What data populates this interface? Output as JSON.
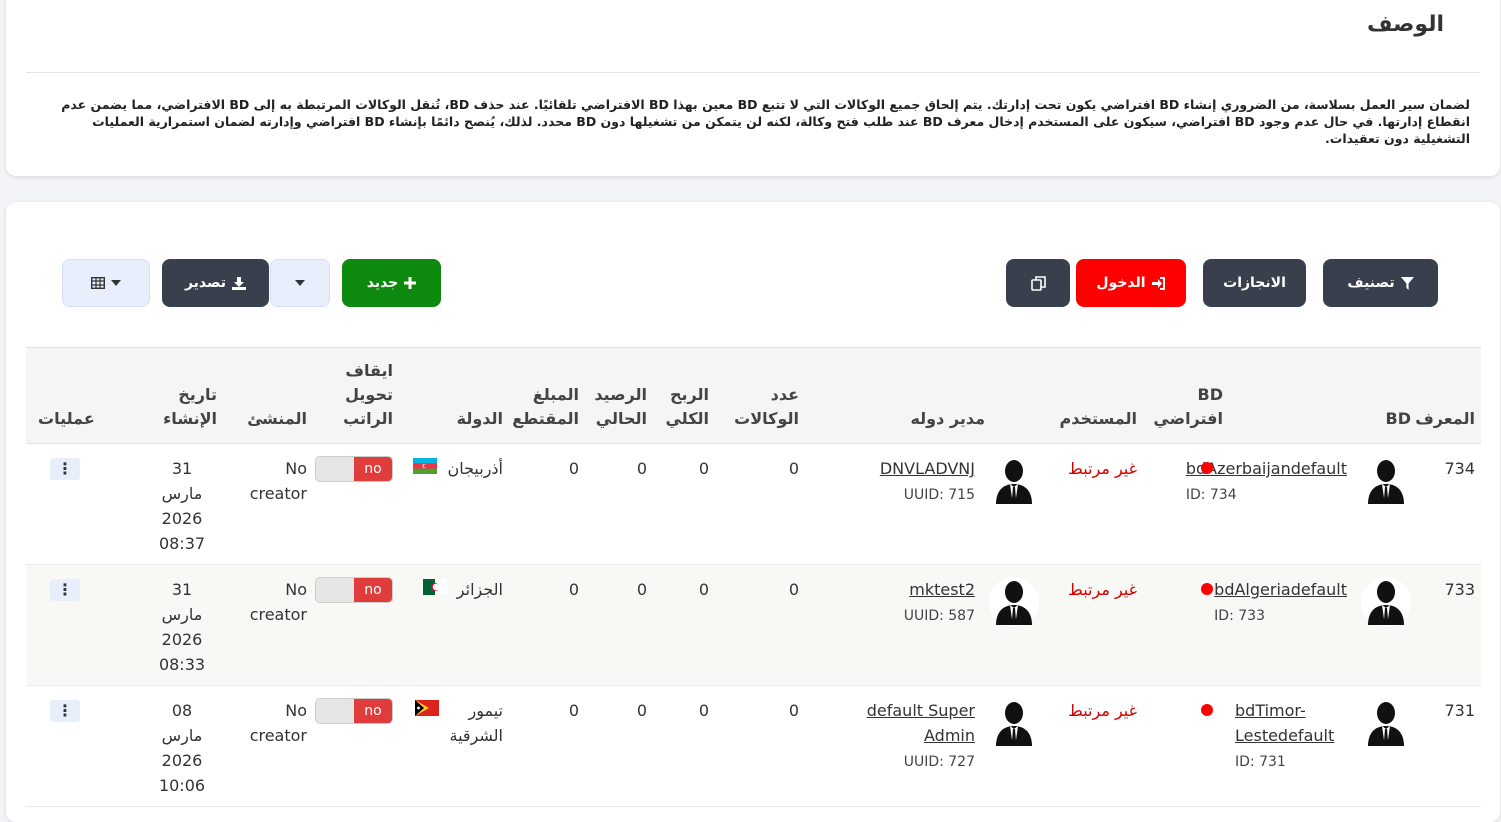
{
  "description": {
    "title": "الوصف",
    "text": "لضمان سير العمل بسلاسة، من الضروري إنشاء BD افتراضي يكون تحت إدارتك. يتم إلحاق جميع الوكالات التي لا تتبع BD معين بهذا BD الافتراضي تلقائيًا. عند حذف BD، تُنقل الوكالات المرتبطة به إلى BD الافتراضي، مما يضمن عدم انقطاع إدارتها. في حال عدم وجود BD افتراضي، سيكون على المستخدم إدخال معرف BD عند طلب فتح وكالة، لكنه لن يتمكن من تشغيلها دون BD محدد. لذلك، يُنصح دائمًا بإنشاء BD افتراضي وإدارته لضمان استمرارية العمليات التشغيلية دون تعقيدات."
  },
  "toolbar": {
    "filter_label": "تصنيف",
    "achievements_label": "الانجازات",
    "login_label": "الدخول",
    "new_label": "جديد",
    "export_label": "تصدير"
  },
  "colors": {
    "login": "#ff0000",
    "new": "#0d8a0d",
    "dark": "#3a3f4d",
    "status_red": "#d40000"
  },
  "table": {
    "headers": {
      "id": "المعرف",
      "bd": "BD",
      "default_bd": "BD افتراضي",
      "user": "المستخدم",
      "manager": "مدير دوله",
      "agency_count": "عدد الوكالات",
      "total_profit": "الربح الكلي",
      "balance": "الرصيد الحالي",
      "deducted": "المبلغ المقتطع",
      "country": "الدولة",
      "stop_salary": "ايقاف تحويل الراتب",
      "creator": "المنشئ",
      "created_at": "تاريخ الإنشاء",
      "actions": "عمليات"
    },
    "rows": [
      {
        "id": "734",
        "bd_name": "bdAzerbaijandefault",
        "bd_id": "ID: 734",
        "user_status": "غير مرتبط",
        "manager_name": "DNVLADVNJ",
        "manager_uuid": "UUID: 715",
        "agency_count": "0",
        "total_profit": "0",
        "balance": "0",
        "deducted": "0",
        "country": "أذربيجان",
        "flag": "azerbaijan-flag",
        "toggle": "no",
        "creator": "No creator",
        "date_day": "31",
        "date_month": "مارس",
        "date_year": "2026",
        "date_time": "08:37"
      },
      {
        "id": "733",
        "bd_name": "bdAlgeriadefault",
        "bd_id": "ID: 733",
        "user_status": "غير مرتبط",
        "manager_name": "mktest2",
        "manager_uuid": "UUID: 587",
        "agency_count": "0",
        "total_profit": "0",
        "balance": "0",
        "deducted": "0",
        "country": "الجزائر",
        "flag": "algeria-flag",
        "toggle": "no",
        "creator": "No creator",
        "date_day": "31",
        "date_month": "مارس",
        "date_year": "2026",
        "date_time": "08:33"
      },
      {
        "id": "731",
        "bd_name": "bdTimor-Lestedefault",
        "bd_id": "ID: 731",
        "user_status": "غير مرتبط",
        "manager_name": "default Super Admin",
        "manager_uuid": "UUID: 727",
        "agency_count": "0",
        "total_profit": "0",
        "balance": "0",
        "deducted": "0",
        "country": "تيمور الشرقية",
        "flag": "timor-leste-flag",
        "toggle": "no",
        "creator": "No creator",
        "date_day": "08",
        "date_month": "مارس",
        "date_year": "2026",
        "date_time": "10:06"
      }
    ]
  }
}
